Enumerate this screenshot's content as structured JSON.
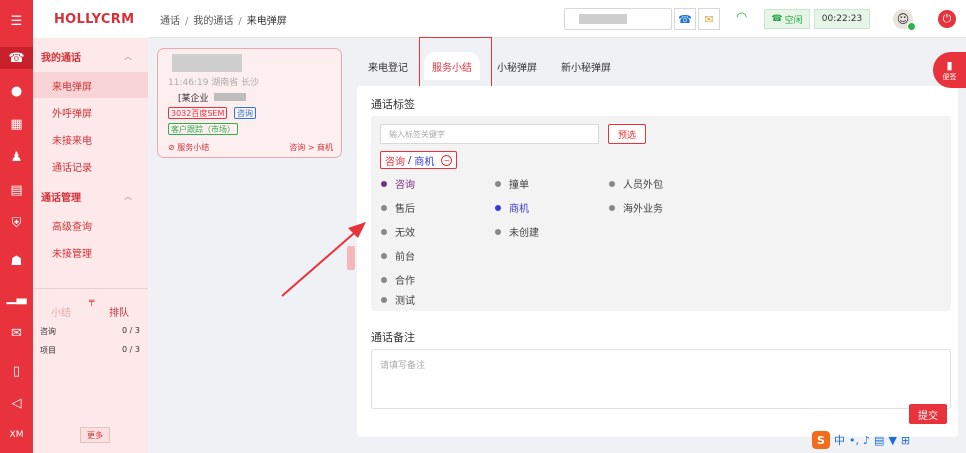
{
  "app": {
    "logo": "HOLLYCRM"
  },
  "rail": {
    "icons": [
      "menu-icon",
      "phone-icon",
      "chat-icon",
      "grid-icon",
      "user-icon",
      "clipboard-icon",
      "shield-icon",
      "robot-icon",
      "bar-chart-icon",
      "message-icon",
      "book-icon",
      "send-icon"
    ],
    "rail_bottom_label": "XM"
  },
  "nav": {
    "group1": "我的通话",
    "group1_items": [
      "来电弹屏",
      "外呼弹屏",
      "未接来电",
      "通话记录"
    ],
    "group2": "通话管理",
    "group2_items": [
      "高级查询",
      "未接管理"
    ],
    "summary_tab": "小结",
    "rank_tab": "排队",
    "stats": [
      {
        "label": "咨询",
        "value": "0 / 3"
      },
      {
        "label": "项目",
        "value": "0 / 3"
      }
    ],
    "more": "更多"
  },
  "breadcrumb": {
    "items": [
      "通话",
      "我的通话",
      "来电弹屏"
    ],
    "sep": "/"
  },
  "topbar": {
    "status": "空闲",
    "timer": "00:22:23"
  },
  "call_card": {
    "time": "11:46:19 湖南省 长沙",
    "company": "[某企业",
    "tags": [
      "3032百度SEM",
      "咨询",
      "客户跟踪（市场）"
    ],
    "summary_link": "服务小结",
    "path": "咨询 > 商机"
  },
  "tabs": [
    "来电登记",
    "服务小结",
    "小秘弹屏",
    "新小秘弹屏"
  ],
  "active_tab": 1,
  "tags_section": {
    "title": "通话标签",
    "search_placeholder": "输入标签关键字",
    "preselect": "预选",
    "chip_a": "咨询",
    "chip_sep": "/",
    "chip_b": "商机",
    "options": [
      {
        "label": "咨询",
        "style": "purple"
      },
      {
        "label": "撞单",
        "style": ""
      },
      {
        "label": "人员外包",
        "style": ""
      },
      {
        "label": "售后",
        "style": ""
      },
      {
        "label": "商机",
        "style": "blue"
      },
      {
        "label": "海外业务",
        "style": ""
      },
      {
        "label": "无效",
        "style": ""
      },
      {
        "label": "未创建",
        "style": ""
      },
      {
        "label": "前台",
        "style": ""
      },
      {
        "label": "合作",
        "style": ""
      },
      {
        "label": "测试",
        "style": ""
      }
    ]
  },
  "note_section": {
    "title": "通话备注",
    "placeholder": "请填写备注"
  },
  "submit": "提交",
  "memo": "便签",
  "ime": {
    "label": "中"
  },
  "colors": {
    "brand": "#e8323c",
    "idle": "#2fb14c",
    "purple": "#7a2f8f",
    "blue": "#3a3ad6"
  }
}
